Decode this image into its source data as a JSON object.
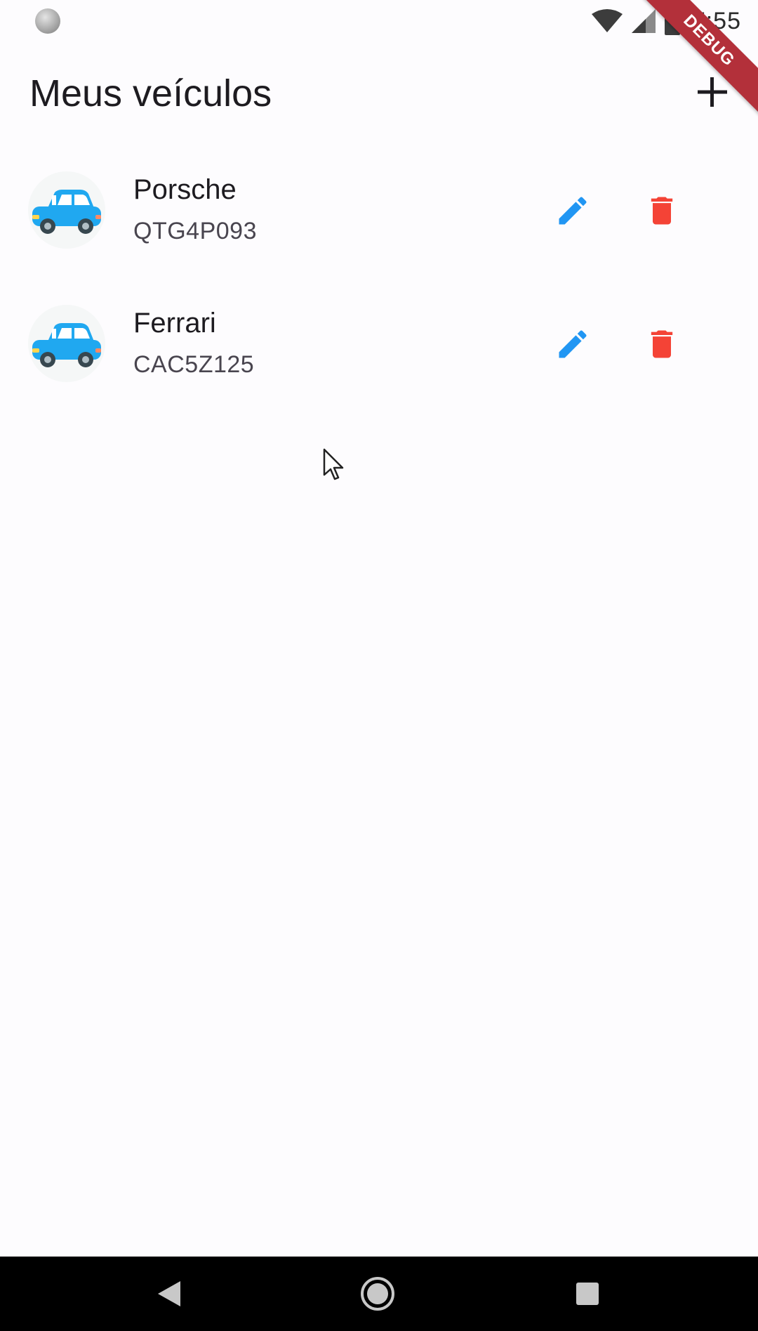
{
  "status_bar": {
    "time": "7:55"
  },
  "debug_banner": {
    "label": "DEBUG"
  },
  "app_bar": {
    "title": "Meus veículos",
    "add_icon": "plus-icon"
  },
  "vehicles": [
    {
      "name": "Porsche",
      "plate": "QTG4P093",
      "avatar_icon": "car-icon",
      "edit_icon": "pencil-icon",
      "delete_icon": "trash-icon"
    },
    {
      "name": "Ferrari",
      "plate": "CAC5Z125",
      "avatar_icon": "car-icon",
      "edit_icon": "pencil-icon",
      "delete_icon": "trash-icon"
    }
  ],
  "colors": {
    "edit": "#2196f3",
    "delete": "#f44336",
    "car_body": "#20a8f0",
    "background": "#fdfcfe",
    "debug_banner": "#b3303a"
  },
  "navigation": {
    "back_icon": "back-triangle-icon",
    "home_icon": "home-circle-icon",
    "recents_icon": "recents-square-icon"
  }
}
